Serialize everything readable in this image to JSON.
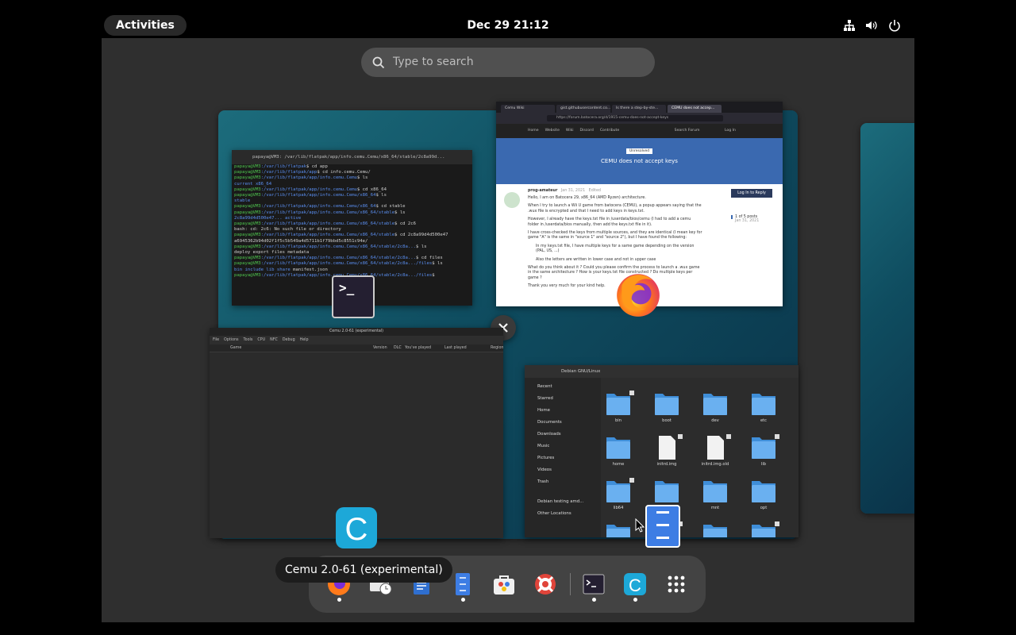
{
  "topbar": {
    "activities_label": "Activities",
    "clock": "Dec 29  21:12",
    "status_icons": [
      "network-wired-icon",
      "volume-icon",
      "power-icon"
    ]
  },
  "search": {
    "placeholder": "Type to search"
  },
  "windows": {
    "terminal": {
      "title": "papaya@VM3: /var/lib/flatpak/app/info.cemu.Cemu/x86_64/stable/2c8a99d...",
      "lines": [
        {
          "u": "papaya@VM3",
          "p": ":/var/lib/flatpak",
          "c": "$ cd app"
        },
        {
          "u": "papaya@VM3",
          "p": ":/var/lib/flatpak/app",
          "c": "$ cd info.cemu.Cemu/"
        },
        {
          "u": "papaya@VM3",
          "p": ":/var/lib/flatpak/app/info.cemu.Cemu",
          "c": "$ ls"
        },
        {
          "u": "",
          "p": "current  x86_64",
          "c": ""
        },
        {
          "u": "papaya@VM3",
          "p": ":/var/lib/flatpak/app/info.cemu.Cemu",
          "c": "$ cd x86_64"
        },
        {
          "u": "papaya@VM3",
          "p": ":/var/lib/flatpak/app/info.cemu.Cemu/x86_64",
          "c": "$ ls"
        },
        {
          "u": "",
          "p": "stable",
          "c": ""
        },
        {
          "u": "papaya@VM3",
          "p": ":/var/lib/flatpak/app/info.cemu.Cemu/x86_64",
          "c": "$ cd stable"
        },
        {
          "u": "papaya@VM3",
          "p": ":/var/lib/flatpak/app/info.cemu.Cemu/x86_64/stable",
          "c": "$ ls"
        },
        {
          "u": "",
          "p": "2c8a99d4d500e47...  active",
          "c": ""
        },
        {
          "u": "papaya@VM3",
          "p": ":/var/lib/flatpak/app/info.cemu.Cemu/x86_64/stable",
          "c": "$ cd 2c6"
        },
        {
          "u": "",
          "p": "",
          "c": "bash: cd: 2c6: No such file or directory"
        },
        {
          "u": "papaya@VM3",
          "p": ":/var/lib/flatpak/app/info.cemu.Cemu/x86_64/stable",
          "c": "$ cd 2c8a99d4d500e47"
        },
        {
          "u": "",
          "p": "",
          "c": "a6945362b94d02f1f5c5b549a4d5711b1f79bbd5c8551c94e/"
        },
        {
          "u": "papaya@VM3",
          "p": ":/var/lib/flatpak/app/info.cemu.Cemu/x86_64/stable/2c8a...",
          "c": "$ ls"
        },
        {
          "u": "",
          "p": "",
          "c": "deploy  export  files  metadata"
        },
        {
          "u": "papaya@VM3",
          "p": ":/var/lib/flatpak/app/info.cemu.Cemu/x86_64/stable/2c8a...",
          "c": "$ cd files"
        },
        {
          "u": "papaya@VM3",
          "p": ":/var/lib/flatpak/app/info.cemu.Cemu/x86_64/stable/2c8a.../files",
          "c": "$ ls"
        },
        {
          "u": "",
          "p": "bin  include  lib  share",
          "c": "  manifest.json"
        },
        {
          "u": "papaya@VM3",
          "p": ":/var/lib/flatpak/app/info.cemu.Cemu/x86_64/stable/2c8a.../files",
          "c": "$ "
        }
      ]
    },
    "browser": {
      "tabs": [
        "Cemu Wiki",
        "gist.githubusercontent.co...",
        "Is there a step-by-ste...",
        "CEMU does not accep..."
      ],
      "url": "https://forum.batocera.org/d/1915-cemu-does-not-accept-keys",
      "nav": [
        "Home",
        "Website",
        "Wiki",
        "Discord",
        "Contribute"
      ],
      "search_label": "Search Forum",
      "login_label": "Log In",
      "tag": "Unresolved",
      "post_title": "CEMU does not accept keys",
      "author": "prog-amateur",
      "date": "Jan 31, 2021",
      "edited": "Edited",
      "body": [
        "Hello, I am on Batocera 29, x86_64 (AMD Ryzen) architecture.",
        "When I try to launch a Wii U game from batocera (CEMU), a popup appears saying that the .wux file is encrypted and that I need to add keys in keys.txt.",
        "However, I already have the keys.txt file in /userdata/bios/cemu (I had to add a cemu folder in /userdata/bios manually, then add the keys.txt file in it).",
        "I have cross-checked the keys from multiple sources, and they are identical (I mean key for game \"A\" is the same in \"source 1\" and \"source 2\"), but I have found the following:",
        "In my keys.txt file, I have multiple keys for a same game depending on the version (PAL, US, ...)",
        "Also the letters are written in lower case and not in upper case",
        "What do you think about it ? Could you please confirm the process to launch a .wux game in the same architecture ? How is your keys.txt file constructed ? Do multiple keys per game ?",
        "Thank you very much for your kind help."
      ],
      "reply_button": "Log In to Reply",
      "posts_count": "1 of 5 posts",
      "posts_date": "Jan 31, 2021"
    },
    "cemu": {
      "title": "Cemu 2.0-61 (experimental)",
      "menu": [
        "File",
        "Options",
        "Tools",
        "CPU",
        "NFC",
        "Debug",
        "Help"
      ],
      "columns": [
        "Game",
        "Version",
        "DLC",
        "You've played",
        "Last played",
        "Region"
      ]
    },
    "files": {
      "title": "Debian GNU/Linux",
      "sidebar": [
        "Recent",
        "Starred",
        "Home",
        "Documents",
        "Downloads",
        "Music",
        "Pictures",
        "Videos",
        "Trash",
        "Debian testing amd...",
        "Other Locations"
      ],
      "items": [
        {
          "name": "bin",
          "type": "folder-link"
        },
        {
          "name": "boot",
          "type": "folder"
        },
        {
          "name": "dev",
          "type": "folder"
        },
        {
          "name": "etc",
          "type": "folder"
        },
        {
          "name": "home",
          "type": "folder"
        },
        {
          "name": "initrd.img",
          "type": "file-link"
        },
        {
          "name": "initrd.img.old",
          "type": "file-link"
        },
        {
          "name": "lib",
          "type": "folder-link"
        },
        {
          "name": "lib64",
          "type": "folder-link"
        },
        {
          "name": "",
          "type": "folder"
        },
        {
          "name": "mnt",
          "type": "folder"
        },
        {
          "name": "opt",
          "type": "folder"
        },
        {
          "name": "",
          "type": "folder"
        },
        {
          "name": "",
          "type": "folder-link"
        },
        {
          "name": "",
          "type": "folder"
        },
        {
          "name": "",
          "type": "folder-link"
        }
      ]
    }
  },
  "tooltip": "Cemu 2.0-61 (experimental)",
  "dock": [
    {
      "name": "firefox",
      "running": true
    },
    {
      "name": "evolution-mail-calendar",
      "running": false
    },
    {
      "name": "libreoffice-writer",
      "running": false
    },
    {
      "name": "files",
      "running": true
    },
    {
      "name": "software",
      "running": false
    },
    {
      "name": "help",
      "running": false
    },
    {
      "name": "terminal",
      "running": true
    },
    {
      "name": "cemu",
      "running": true
    },
    {
      "name": "show-apps",
      "running": false
    }
  ]
}
